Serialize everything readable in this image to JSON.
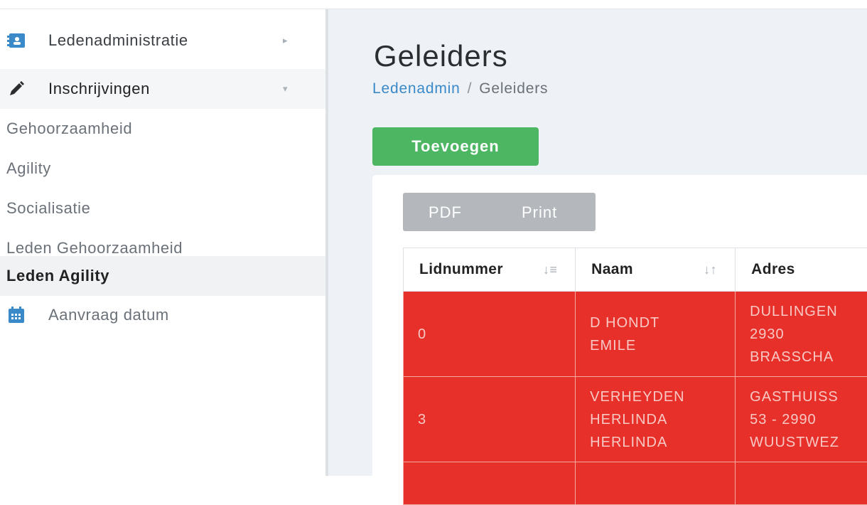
{
  "sidebar": {
    "items": [
      {
        "label": "Ledenadministratie",
        "icon": "contact-card-icon",
        "arrow": "▸"
      },
      {
        "label": "Inschrijvingen",
        "icon": "pencil-icon",
        "arrow": "▾"
      }
    ],
    "sub_items": [
      {
        "label": "Gehoorzaamheid"
      },
      {
        "label": "Agility"
      },
      {
        "label": "Socialisatie"
      },
      {
        "label": "Leden Gehoorzaamheid"
      },
      {
        "label": "Leden Agility"
      }
    ],
    "bottom_item": {
      "label": "Aanvraag datum",
      "icon": "calendar-icon"
    }
  },
  "page": {
    "title": "Geleiders",
    "breadcrumb": {
      "link": "Ledenadmin",
      "separator": "/",
      "current": "Geleiders"
    },
    "add_button": "Toevoegen",
    "export": {
      "pdf": "PDF",
      "print": "Print"
    }
  },
  "table": {
    "columns": [
      "Lidnummer",
      "Naam",
      "Adres"
    ],
    "rows": [
      {
        "lidnummer": "0",
        "naam": [
          "D HONDT",
          "EMILE"
        ],
        "adres": [
          "DULLINGEN",
          "2930",
          "BRASSCHA"
        ]
      },
      {
        "lidnummer": "3",
        "naam": [
          "VERHEYDEN",
          "HERLINDA",
          "HERLINDA"
        ],
        "adres": [
          "GASTHUISS",
          "53 - 2990",
          "WUUSTWEZ"
        ]
      }
    ]
  },
  "colors": {
    "accent": "#4cb662",
    "row_red": "#e8302a",
    "link": "#3a89c9"
  }
}
